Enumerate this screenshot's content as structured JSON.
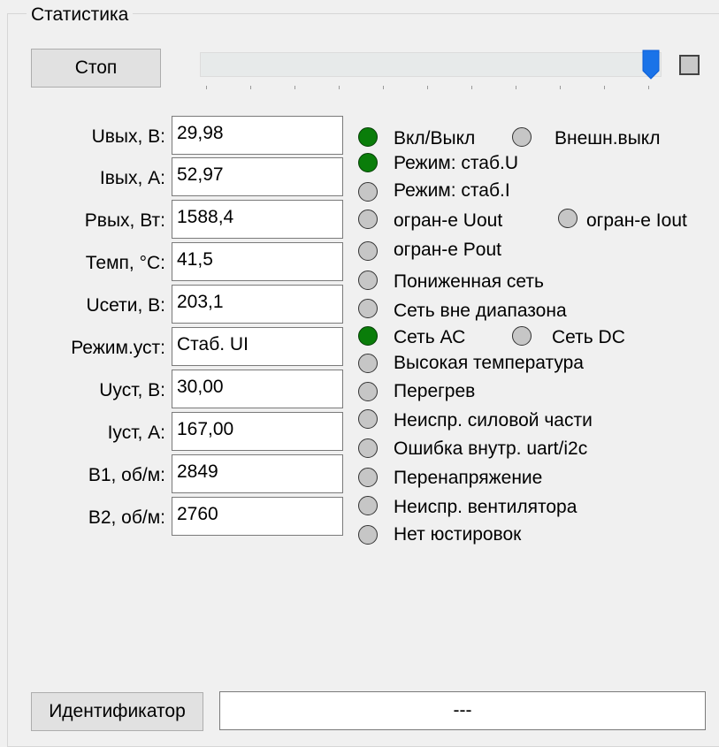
{
  "group": {
    "title": "Статистика"
  },
  "controls": {
    "stop_label": "Стоп",
    "slider_level": 1.0,
    "identifier_label": "Идентификатор",
    "identifier_value": "---"
  },
  "fields": [
    {
      "label": "Uвых, В:",
      "value": "29,98"
    },
    {
      "label": "Iвых, А:",
      "value": "52,97"
    },
    {
      "label": "Рвых, Вт:",
      "value": "1588,4"
    },
    {
      "label": "Темп, °С:",
      "value": "41,5"
    },
    {
      "label": "Uсети, В:",
      "value": "203,1"
    },
    {
      "label": "Режим.уст:",
      "value": "Стаб. UI"
    },
    {
      "label": "Uуст, В:",
      "value": "30,00"
    },
    {
      "label": "Iуст, А:",
      "value": "167,00"
    },
    {
      "label": "В1, об/м:",
      "value": "2849"
    },
    {
      "label": "В2, об/м:",
      "value": "2760"
    }
  ],
  "status": [
    {
      "text": "Вкл/Выкл",
      "on": true
    },
    {
      "text": "Внешн.выкл",
      "on": false
    },
    {
      "text": "Режим: стаб.U",
      "on": true
    },
    {
      "text": "Режим: стаб.I",
      "on": false
    },
    {
      "text": "огран-е Uout",
      "on": false
    },
    {
      "text": "огран-е Iout",
      "on": false
    },
    {
      "text": "огран-е Pout",
      "on": false
    },
    {
      "text": "Пониженная сеть",
      "on": false
    },
    {
      "text": "Сеть вне диапазона",
      "on": false
    },
    {
      "text": "Сеть АС",
      "on": true
    },
    {
      "text": "Сеть DC",
      "on": false
    },
    {
      "text": "Высокая температура",
      "on": false
    },
    {
      "text": "Перегрев",
      "on": false
    },
    {
      "text": "Неиспр. силовой части",
      "on": false
    },
    {
      "text": "Ошибка внутр. uart/i2c",
      "on": false
    },
    {
      "text": "Перенапряжение",
      "on": false
    },
    {
      "text": "Неиспр. вентилятора",
      "on": false
    },
    {
      "text": "Нет юстировок",
      "on": false
    }
  ],
  "colors": {
    "led_on": "#0a7d0a",
    "led_off": "#c6c6c6",
    "slider_thumb": "#1a73e8"
  }
}
